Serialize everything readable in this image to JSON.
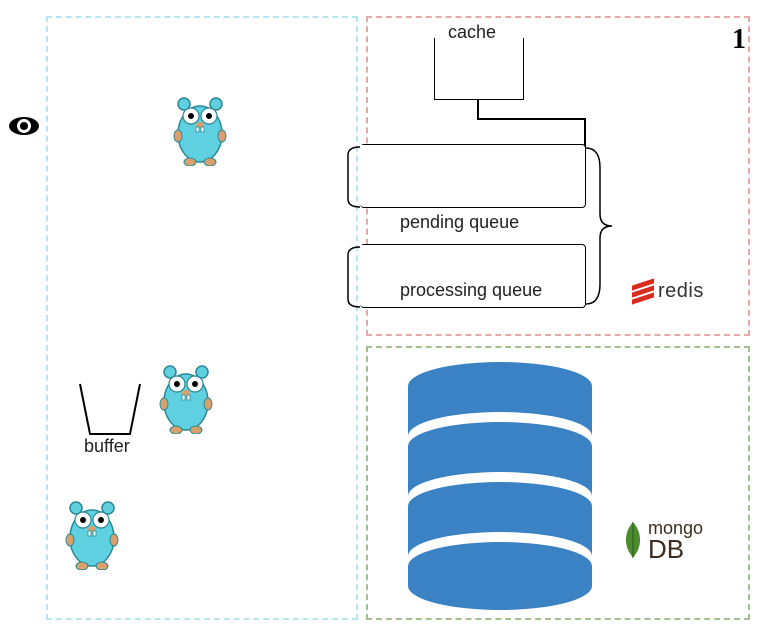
{
  "labels": {
    "cache": "cache",
    "pending_queue": "pending queue",
    "processing_queue": "processing queue",
    "buffer": "buffer",
    "one": "1"
  },
  "logos": {
    "redis": "redis",
    "mongo_top": "mongo",
    "mongo_bottom": "DB"
  },
  "colors": {
    "gopher_body": "#5ed0e0",
    "gopher_outline": "#2a8794",
    "db_fill": "#3a82c4",
    "mongo_green": "#4a8b2e",
    "redis_red": "#d82c20"
  }
}
